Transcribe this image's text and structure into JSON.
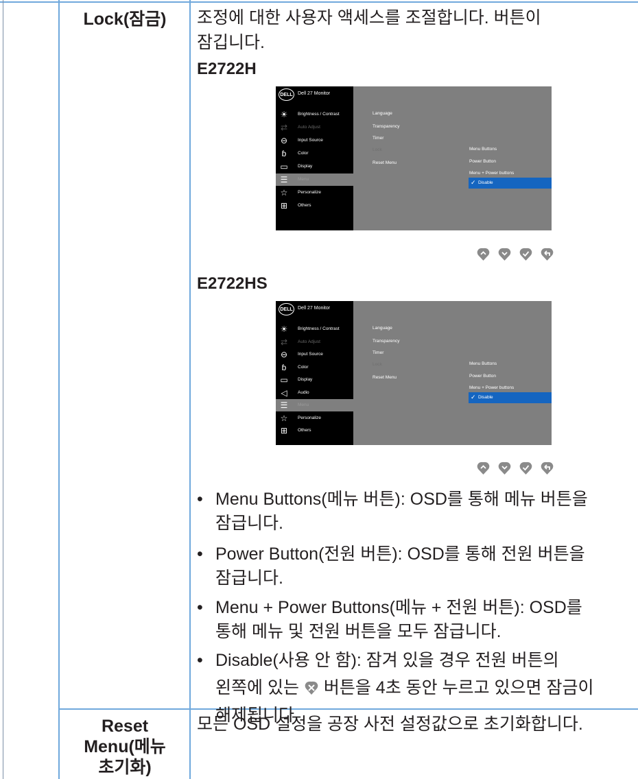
{
  "rows": [
    {
      "label": "Lock(잠금)",
      "description_line1": "조정에 대한 사용자 액세스를 조절합니다. 버튼이",
      "description_line2": "잠깁니다.",
      "models": [
        "E2722H",
        "E2722HS"
      ],
      "bullets": [
        {
          "line1": "Menu Buttons(메뉴 버튼): OSD를 통해 메뉴 버튼을",
          "line2": "잠급니다."
        },
        {
          "line1": "Power Button(전원 버튼): OSD를 통해 전원 버튼을",
          "line2": "잠급니다."
        },
        {
          "line1": "Menu + Power Buttons(메뉴 + 전원 버튼): OSD를",
          "line2": "통해 메뉴 및 전원 버튼을 모두 잠급니다."
        },
        {
          "line1": "Disable(사용 안 함): 잠겨 있을 경우 전원 버튼의",
          "line2a": "왼쪽에 있는",
          "line2b": "버튼을 4초 동안 누르고 있으면 잠금이",
          "line3": "해제됩니다."
        }
      ]
    },
    {
      "label_line1": "Reset",
      "label_line2": "Menu(메뉴",
      "label_line3": "초기화)",
      "description": "모든 OSD 설정을 공장 사전 설정값으로 초기화합니다."
    }
  ],
  "osd": {
    "logo": "DELL",
    "title": "Dell 27 Monitor",
    "menu_h": [
      {
        "icon": "brightness-icon",
        "label": "Brightness / Contrast"
      },
      {
        "icon": "auto-adjust-icon",
        "label": "Auto Adjust"
      },
      {
        "icon": "input-source-icon",
        "label": "Input Source"
      },
      {
        "icon": "color-icon",
        "label": "Color"
      },
      {
        "icon": "display-icon",
        "label": "Display"
      },
      {
        "icon": "menu-icon",
        "label": "Menu"
      },
      {
        "icon": "personalize-icon",
        "label": "Personalize"
      },
      {
        "icon": "others-icon",
        "label": "Others"
      }
    ],
    "menu_hs": [
      {
        "icon": "brightness-icon",
        "label": "Brightness / Contrast"
      },
      {
        "icon": "auto-adjust-icon",
        "label": "Auto Adjust"
      },
      {
        "icon": "input-source-icon",
        "label": "Input Source"
      },
      {
        "icon": "color-icon",
        "label": "Color"
      },
      {
        "icon": "display-icon",
        "label": "Display"
      },
      {
        "icon": "audio-icon",
        "label": "Audio"
      },
      {
        "icon": "menu-icon",
        "label": "Menu"
      },
      {
        "icon": "personalize-icon",
        "label": "Personalize"
      },
      {
        "icon": "others-icon",
        "label": "Others"
      }
    ],
    "submenu": [
      "Language",
      "Transparency",
      "Timer",
      "Lock",
      "Reset Menu"
    ],
    "options": [
      "Menu Buttons",
      "Power Button",
      "Menu + Power buttons",
      "Disable"
    ],
    "selected_option": "Disable",
    "nav_buttons": [
      "up-arrow-icon",
      "down-arrow-icon",
      "check-icon",
      "back-icon"
    ],
    "colors": {
      "selection": "#1565c0",
      "panel": "#7f7f7f",
      "sidebar": "#000000",
      "grid": "#6fa8dc"
    }
  }
}
